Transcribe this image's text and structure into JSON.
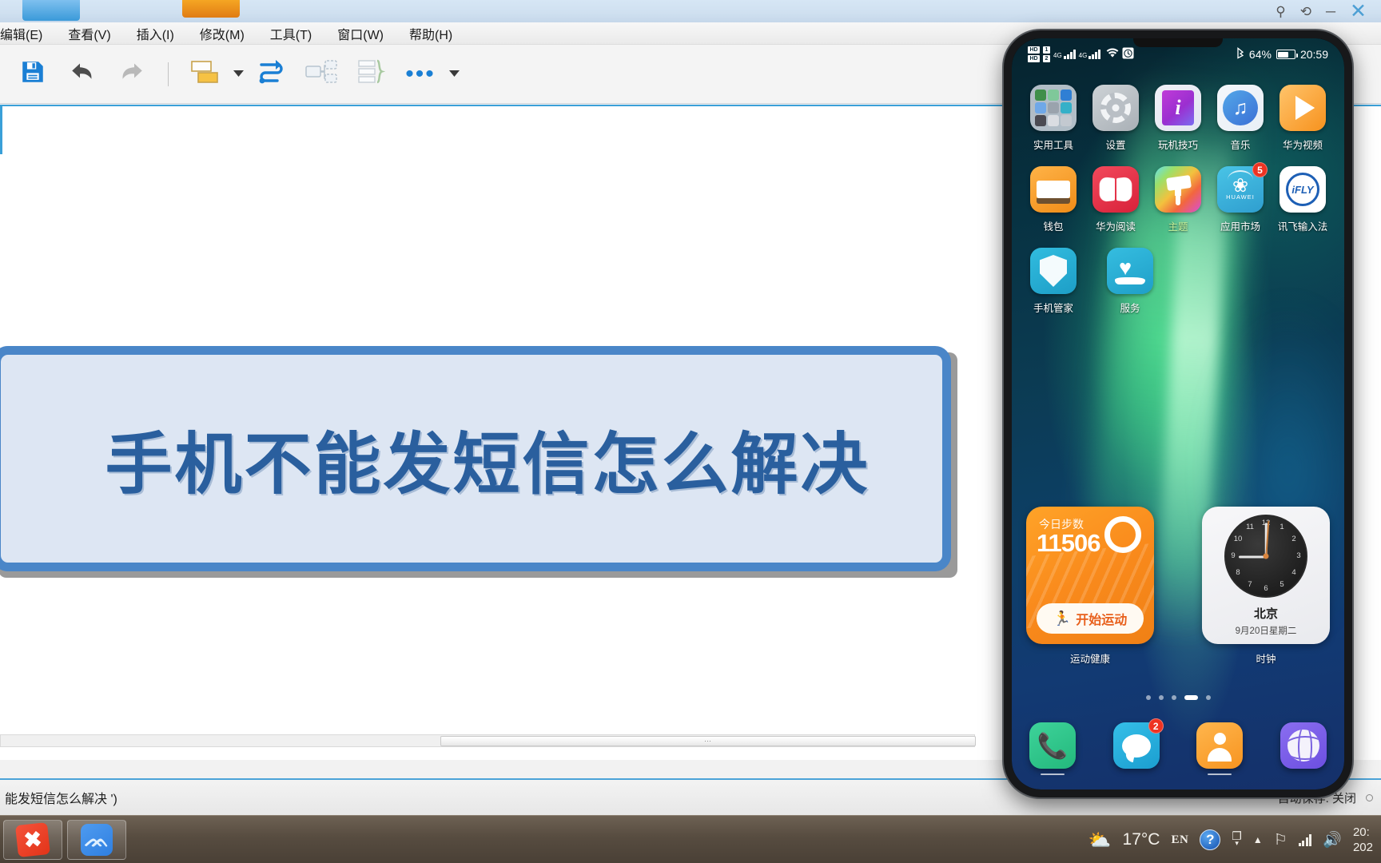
{
  "app": {
    "menu_items": [
      "编辑(E)",
      "查看(V)",
      "插入(I)",
      "修改(M)",
      "工具(T)",
      "窗口(W)",
      "帮助(H)"
    ],
    "window_controls": {
      "pin": "pin-icon",
      "restore": "restore-icon",
      "minimize": "minimize-icon",
      "close": "close-icon"
    },
    "toolbar": {
      "save": "save-icon",
      "undo": "undo-icon",
      "redo": "redo-icon",
      "topic": "subtopic-icon",
      "topic_caret": "chevron-down-icon",
      "relationship": "relationship-arrow-icon",
      "summary": "summary-icon",
      "boundary": "boundary-brace-icon",
      "more": "•••",
      "more_caret": "chevron-down-icon"
    },
    "canvas": {
      "central_topic": "手机不能发短信怎么解决",
      "scrollbar_grip": "⋯"
    },
    "statusbar": {
      "left_text": "能发短信怎么解决 ')",
      "autosave": "自动保存: 关闭"
    },
    "colors": {
      "topic_border": "#4a86c8",
      "topic_fill": "#dde6f3",
      "topic_text": "#2a5f9e",
      "accent": "#3aa0d8"
    }
  },
  "phone": {
    "statusbar": {
      "sim1_chip": "VoLTE",
      "sim1_letter": "1",
      "sim2_chip": "VoLTE",
      "sim2_letter": "2",
      "net1": "4G",
      "net2": "4G",
      "wifi": "wifi-icon",
      "alarm": "alarm-clock-icon",
      "bluetooth": "bluetooth-icon",
      "battery_percent": "64%",
      "battery_level": 64,
      "time": "20:59"
    },
    "apps": [
      [
        {
          "name": "实用工具",
          "icon": "utilities-folder-icon"
        },
        {
          "name": "设置",
          "icon": "settings-gear-icon"
        },
        {
          "name": "玩机技巧",
          "icon": "tips-icon"
        },
        {
          "name": "音乐",
          "icon": "music-icon"
        },
        {
          "name": "华为视频",
          "icon": "huawei-video-icon"
        }
      ],
      [
        {
          "name": "钱包",
          "icon": "wallet-icon"
        },
        {
          "name": "华为阅读",
          "icon": "huawei-reader-icon"
        },
        {
          "name": "主题",
          "icon": "themes-brush-icon"
        },
        {
          "name": "应用市场",
          "icon": "app-gallery-icon",
          "badge": "5"
        },
        {
          "name": "讯飞输入法",
          "icon": "ifly-input-icon"
        }
      ],
      [
        {
          "name": "手机管家",
          "icon": "phone-manager-shield-icon"
        },
        {
          "name": "服务",
          "icon": "service-heart-icon"
        }
      ]
    ],
    "widgets": {
      "health": {
        "steps_label": "今日步数",
        "steps_value": "11506",
        "button_label": "开始运动",
        "button_icon": "runner-icon",
        "ring_icon": "progress-ring-icon",
        "widget_label": "运动健康"
      },
      "clock": {
        "city": "北京",
        "date": "9月20日星期二",
        "widget_label": "时钟",
        "numerals": [
          "12",
          "1",
          "2",
          "3",
          "4",
          "5",
          "6",
          "7",
          "8",
          "9",
          "10",
          "11"
        ]
      }
    },
    "page_dots": {
      "count": 5,
      "active_index": 3
    },
    "dock": [
      {
        "name": "电话",
        "icon": "phone-handset-icon"
      },
      {
        "name": "信息",
        "icon": "message-bubble-icon",
        "badge": "2"
      },
      {
        "name": "联系人",
        "icon": "contacts-person-icon"
      },
      {
        "name": "浏览器",
        "icon": "browser-globe-icon"
      }
    ]
  },
  "taskbar": {
    "apps": [
      {
        "name": "XMind",
        "icon": "xmind-icon",
        "glyph": "✖"
      },
      {
        "name": "投屏助手",
        "icon": "screen-mirror-icon",
        "glyph": "ᨏ"
      }
    ],
    "tray": {
      "weather_icon": "partly-cloudy-icon",
      "temperature": "17°C",
      "language": "EN",
      "help_icon": "?",
      "window_switch_icon": "window-switch-icon",
      "show_hidden_icon": "▲",
      "flag_icon": "flag-icon",
      "network_icon": "network-signal-icon",
      "volume_icon": "volume-icon",
      "clock_time": "20:",
      "clock_date": "202"
    }
  }
}
